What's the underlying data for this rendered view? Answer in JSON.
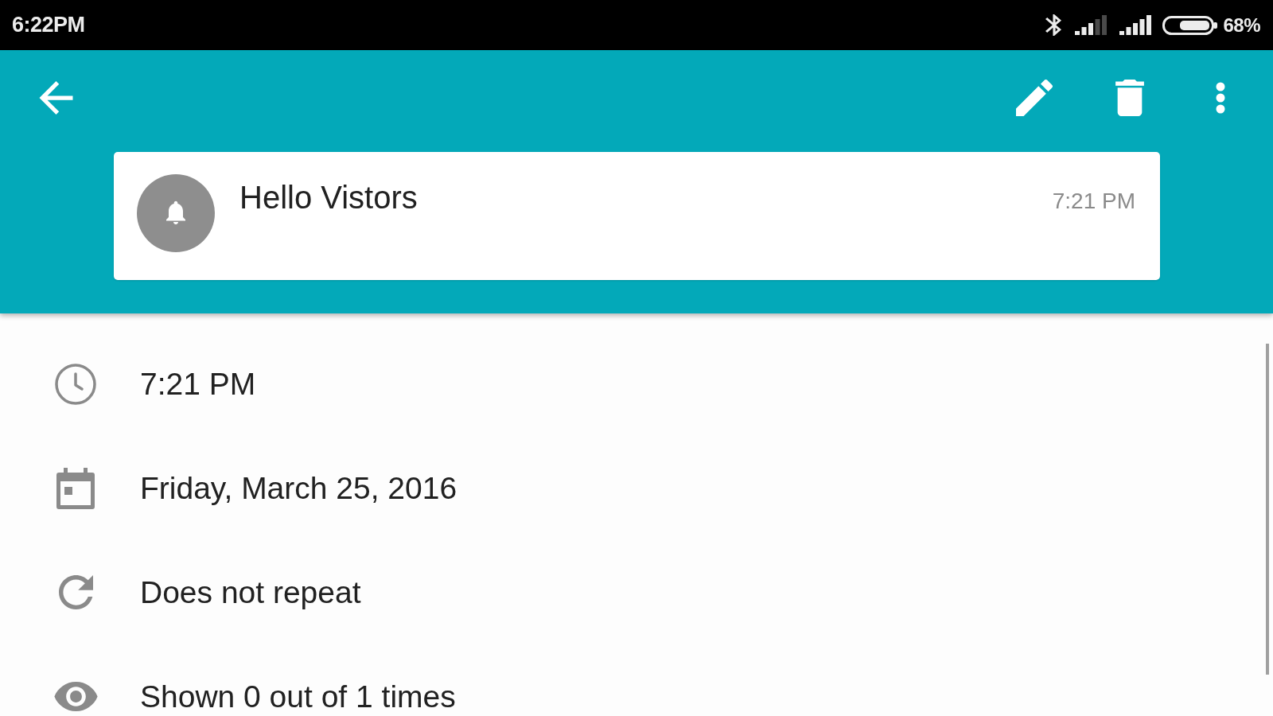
{
  "status_bar": {
    "time": "6:22PM",
    "battery": "68%"
  },
  "reminder": {
    "title": "Hello Vistors",
    "time": "7:21 PM"
  },
  "details": [
    {
      "kind": "time",
      "text": "7:21 PM"
    },
    {
      "kind": "date",
      "text": "Friday, March 25, 2016"
    },
    {
      "kind": "repeat",
      "text": "Does not repeat"
    },
    {
      "kind": "views",
      "text": "Shown 0 out of 1 times"
    }
  ]
}
